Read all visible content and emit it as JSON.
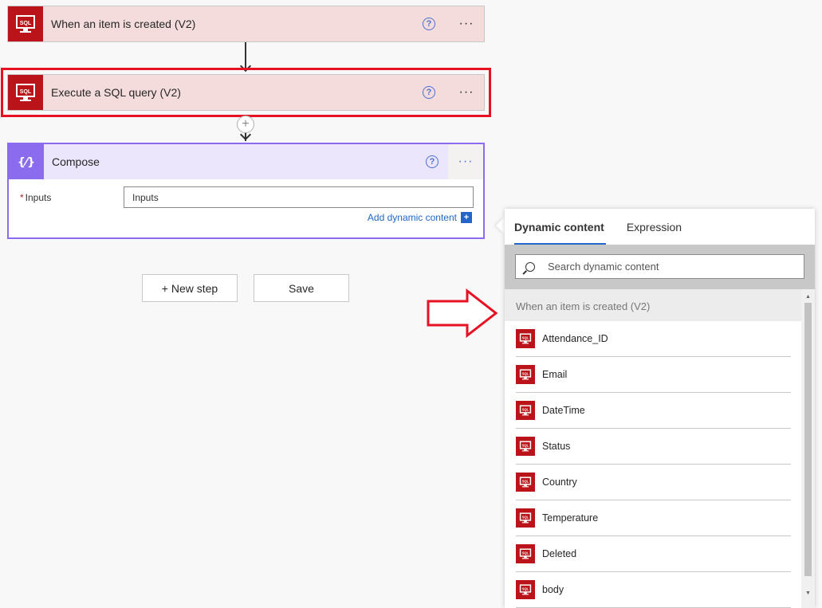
{
  "flow": {
    "trigger": {
      "title": "When an item is created (V2)"
    },
    "action": {
      "title": "Execute a SQL query (V2)"
    },
    "compose": {
      "title": "Compose",
      "inputs_label": "Inputs",
      "inputs_placeholder": "Inputs",
      "add_dynamic_label": "Add dynamic content"
    },
    "new_step_label": "+ New step",
    "save_label": "Save"
  },
  "icons": {
    "sql": "sql-server-icon",
    "compose": "compose-braces-icon",
    "help": "help-icon",
    "more": "more-icon"
  },
  "colors": {
    "sql_brand": "#ba141a",
    "compose_brand": "#8c6cee",
    "highlight": "#e81123",
    "link": "#2266c8"
  },
  "panel": {
    "tabs": [
      "Dynamic content",
      "Expression"
    ],
    "search_placeholder": "Search dynamic content",
    "group_title": "When an item is created (V2)",
    "items": [
      "Attendance_ID",
      "Email",
      "DateTime",
      "Status",
      "Country",
      "Temperature",
      "Deleted",
      "body"
    ]
  }
}
